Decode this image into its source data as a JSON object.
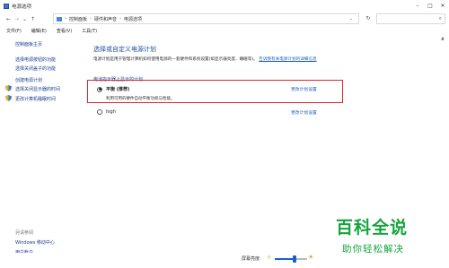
{
  "window": {
    "title": "电源选项"
  },
  "address": {
    "breadcrumbs": [
      "控制面板",
      "硬件和声音",
      "电源选项"
    ]
  },
  "menu": [
    "文件(F)",
    "编辑(E)",
    "查看(V)",
    "工具(T)"
  ],
  "sidebar": {
    "links": [
      "控制面板主页",
      "选择电源按钮的功能",
      "选择关闭盖子的功能",
      "创建电源计划",
      "选择关闭显示器的时间",
      "更改计算机睡眠时间"
    ],
    "see_also_heading": "另请参阅",
    "see_also": [
      "Windows 移动中心",
      "用户帐户"
    ]
  },
  "main": {
    "title": "选择或自定义电源计划",
    "description": "电源计划是用于管理计算机如何使用电源的一套硬件和系统设置(如显示器亮度、睡眠等)。",
    "description_link": "告诉我有关电源计划的详细信息",
    "section_label": "电池指示器上显示的计划",
    "plans": [
      {
        "name": "平衡 (推荐)",
        "subtitle": "利用可用的硬件自动平衡功耗与性能。",
        "selected": true,
        "settings_link": "更改计划设置"
      },
      {
        "name": "high",
        "subtitle": "",
        "selected": false,
        "settings_link": "更改计划设置"
      }
    ]
  },
  "bottom": {
    "brightness_label": "屏幕亮度:",
    "brightness_level": 0.6
  },
  "watermark": {
    "top": "百科全说",
    "bottom": "助你轻松解决"
  },
  "colors": {
    "link": "#1a5fcc",
    "highlight": "#e0262e",
    "watermark": "#16a43c"
  }
}
